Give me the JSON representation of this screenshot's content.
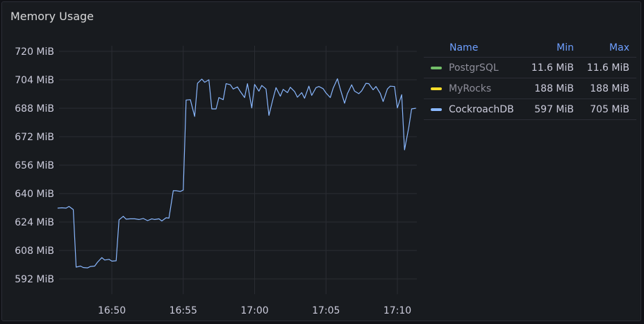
{
  "panel": {
    "title": "Memory Usage"
  },
  "legend": {
    "headers": {
      "name": "Name",
      "min": "Min",
      "max": "Max"
    },
    "rows": [
      {
        "name": "PostgrSQL",
        "min": "11.6 MiB",
        "max": "11.6 MiB",
        "color": "#73bf69",
        "muted": true
      },
      {
        "name": "MyRocks",
        "min": "188 MiB",
        "max": "188 MiB",
        "color": "#fade2a",
        "muted": true
      },
      {
        "name": "CockroachDB",
        "min": "597 MiB",
        "max": "705 MiB",
        "color": "#8ab8ff",
        "muted": false
      }
    ]
  },
  "chart_data": {
    "type": "line",
    "y_ticks": [
      "720 MiB",
      "704 MiB",
      "688 MiB",
      "672 MiB",
      "656 MiB",
      "640 MiB",
      "624 MiB",
      "608 MiB",
      "592 MiB"
    ],
    "y_tick_values": [
      720,
      704,
      688,
      672,
      656,
      640,
      624,
      608,
      592
    ],
    "x_ticks": [
      "16:50",
      "16:55",
      "17:00",
      "17:05",
      "17:10"
    ],
    "x_tick_minutes": [
      50,
      55,
      60,
      65,
      70
    ],
    "x_range_minutes": [
      46.2,
      71.3
    ],
    "ylim": [
      584,
      724
    ],
    "grid": true,
    "series": [
      {
        "name": "CockroachDB",
        "color": "#8ab8ff",
        "points": [
          [
            46.2,
            631.8
          ],
          [
            46.5,
            632.0
          ],
          [
            46.8,
            631.8
          ],
          [
            47.0,
            632.8
          ],
          [
            47.3,
            631.0
          ],
          [
            47.5,
            598.6
          ],
          [
            47.8,
            599.2
          ],
          [
            48.0,
            598.4
          ],
          [
            48.3,
            598.2
          ],
          [
            48.5,
            599.0
          ],
          [
            48.8,
            599.2
          ],
          [
            49.0,
            601.4
          ],
          [
            49.3,
            604.0
          ],
          [
            49.5,
            602.6
          ],
          [
            49.8,
            603.0
          ],
          [
            50.0,
            602.0
          ],
          [
            50.3,
            602.2
          ],
          [
            50.5,
            625.2
          ],
          [
            50.8,
            627.2
          ],
          [
            51.0,
            625.6
          ],
          [
            51.3,
            625.8
          ],
          [
            51.6,
            625.8
          ],
          [
            51.9,
            625.4
          ],
          [
            52.2,
            626.0
          ],
          [
            52.5,
            624.8
          ],
          [
            52.8,
            625.8
          ],
          [
            53.0,
            625.4
          ],
          [
            53.3,
            625.8
          ],
          [
            53.5,
            624.6
          ],
          [
            53.8,
            626.4
          ],
          [
            54.0,
            626.2
          ],
          [
            54.3,
            641.6
          ],
          [
            54.5,
            641.6
          ],
          [
            54.8,
            641.2
          ],
          [
            55.0,
            642.0
          ],
          [
            55.2,
            692.6
          ],
          [
            55.5,
            692.8
          ],
          [
            55.8,
            683.4
          ],
          [
            56.0,
            702.0
          ],
          [
            56.3,
            704.4
          ],
          [
            56.5,
            702.6
          ],
          [
            56.8,
            704.0
          ],
          [
            57.0,
            687.6
          ],
          [
            57.3,
            687.6
          ],
          [
            57.5,
            694.0
          ],
          [
            57.8,
            692.8
          ],
          [
            58.0,
            701.8
          ],
          [
            58.3,
            701.2
          ],
          [
            58.5,
            698.8
          ],
          [
            58.8,
            700.0
          ],
          [
            59.0,
            697.4
          ],
          [
            59.3,
            694.0
          ],
          [
            59.5,
            701.8
          ],
          [
            59.8,
            688.2
          ],
          [
            60.0,
            701.4
          ],
          [
            60.3,
            697.6
          ],
          [
            60.5,
            700.8
          ],
          [
            60.8,
            698.8
          ],
          [
            61.0,
            684.0
          ],
          [
            61.3,
            693.6
          ],
          [
            61.5,
            699.6
          ],
          [
            61.8,
            694.8
          ],
          [
            62.0,
            698.6
          ],
          [
            62.3,
            696.8
          ],
          [
            62.5,
            699.8
          ],
          [
            62.8,
            697.4
          ],
          [
            63.0,
            694.2
          ],
          [
            63.3,
            696.8
          ],
          [
            63.5,
            693.6
          ],
          [
            63.8,
            700.4
          ],
          [
            64.0,
            695.2
          ],
          [
            64.3,
            699.6
          ],
          [
            64.5,
            700.2
          ],
          [
            64.8,
            699.0
          ],
          [
            65.0,
            696.6
          ],
          [
            65.3,
            694.0
          ],
          [
            65.5,
            699.2
          ],
          [
            65.8,
            704.6
          ],
          [
            66.0,
            698.8
          ],
          [
            66.3,
            690.8
          ],
          [
            66.5,
            696.2
          ],
          [
            66.8,
            701.2
          ],
          [
            67.0,
            697.6
          ],
          [
            67.3,
            696.2
          ],
          [
            67.5,
            697.8
          ],
          [
            67.8,
            702.0
          ],
          [
            68.0,
            701.8
          ],
          [
            68.3,
            698.4
          ],
          [
            68.5,
            700.2
          ],
          [
            68.8,
            696.4
          ],
          [
            69.0,
            691.8
          ],
          [
            69.3,
            698.8
          ],
          [
            69.5,
            700.4
          ],
          [
            69.8,
            700.2
          ],
          [
            70.0,
            688.2
          ],
          [
            70.3,
            695.6
          ],
          [
            70.5,
            664.6
          ],
          [
            70.8,
            677.2
          ],
          [
            71.0,
            687.6
          ],
          [
            71.3,
            688.0
          ]
        ]
      }
    ]
  }
}
